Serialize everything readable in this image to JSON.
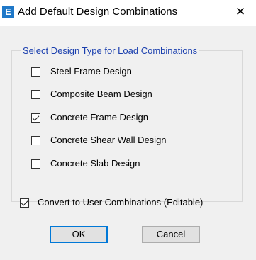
{
  "window": {
    "icon_letter": "E",
    "title": "Add Default Design Combinations",
    "close_glyph": "✕"
  },
  "group": {
    "legend": "Select Design Type for Load Combinations",
    "options": [
      {
        "label": "Steel Frame Design",
        "checked": false
      },
      {
        "label": "Composite Beam Design",
        "checked": false
      },
      {
        "label": "Concrete Frame Design",
        "checked": true
      },
      {
        "label": "Concrete Shear Wall Design",
        "checked": false
      },
      {
        "label": "Concrete Slab Design",
        "checked": false
      }
    ]
  },
  "convert": {
    "label": "Convert to User Combinations (Editable)",
    "checked": true
  },
  "buttons": {
    "ok": "OK",
    "cancel": "Cancel"
  }
}
